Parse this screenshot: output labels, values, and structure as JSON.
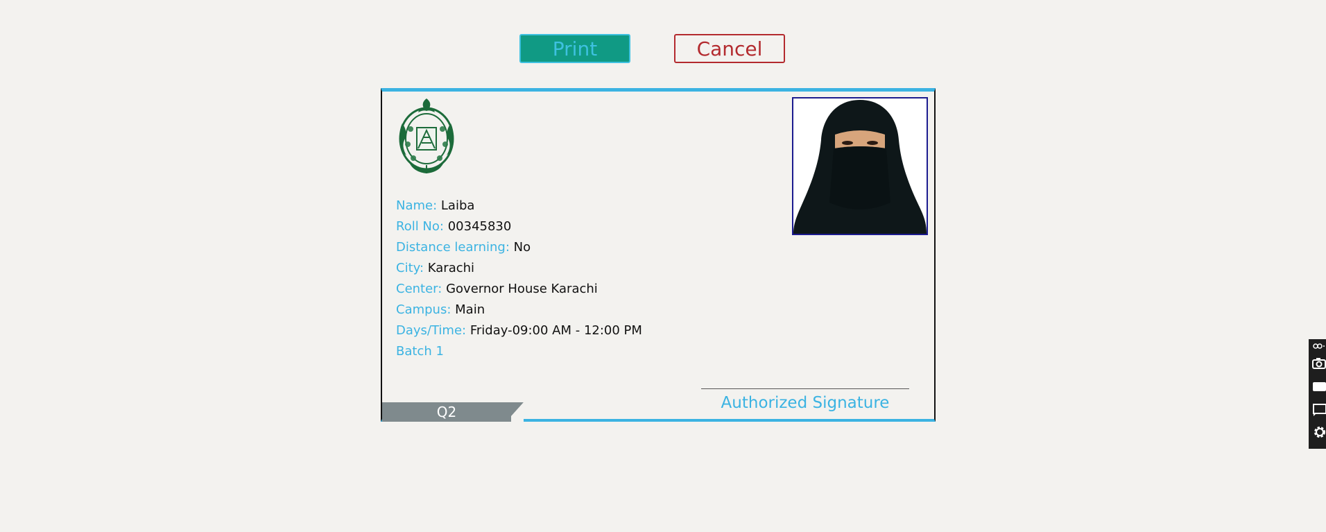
{
  "toolbar": {
    "print_label": "Print",
    "cancel_label": "Cancel"
  },
  "card": {
    "fields": [
      {
        "label": "Name:",
        "value": "Laiba"
      },
      {
        "label": "Roll No:",
        "value": "00345830"
      },
      {
        "label": "Distance learning:",
        "value": "No"
      },
      {
        "label": "City:",
        "value": "Karachi"
      },
      {
        "label": "Center:",
        "value": "Governor House Karachi"
      },
      {
        "label": "Campus:",
        "value": "Main"
      },
      {
        "label": "Days/Time:",
        "value": "Friday-09:00 AM - 12:00 PM"
      },
      {
        "label": "Batch 1",
        "value": ""
      }
    ],
    "signature_label": "Authorized Signature",
    "quarter_label": "Q2",
    "logo_icon": "government-emblem-icon",
    "photo_icon": "student-photo"
  },
  "side_toolbar": {
    "icons": [
      "link-icon",
      "camera-icon",
      "video-icon",
      "window-icon",
      "gear-icon"
    ]
  },
  "colors": {
    "accent": "#3bb3e2",
    "print_bg": "#109a84",
    "cancel": "#b32a2e",
    "tab_gray": "#7f8a8d",
    "emblem_green": "#1c6b3a"
  }
}
